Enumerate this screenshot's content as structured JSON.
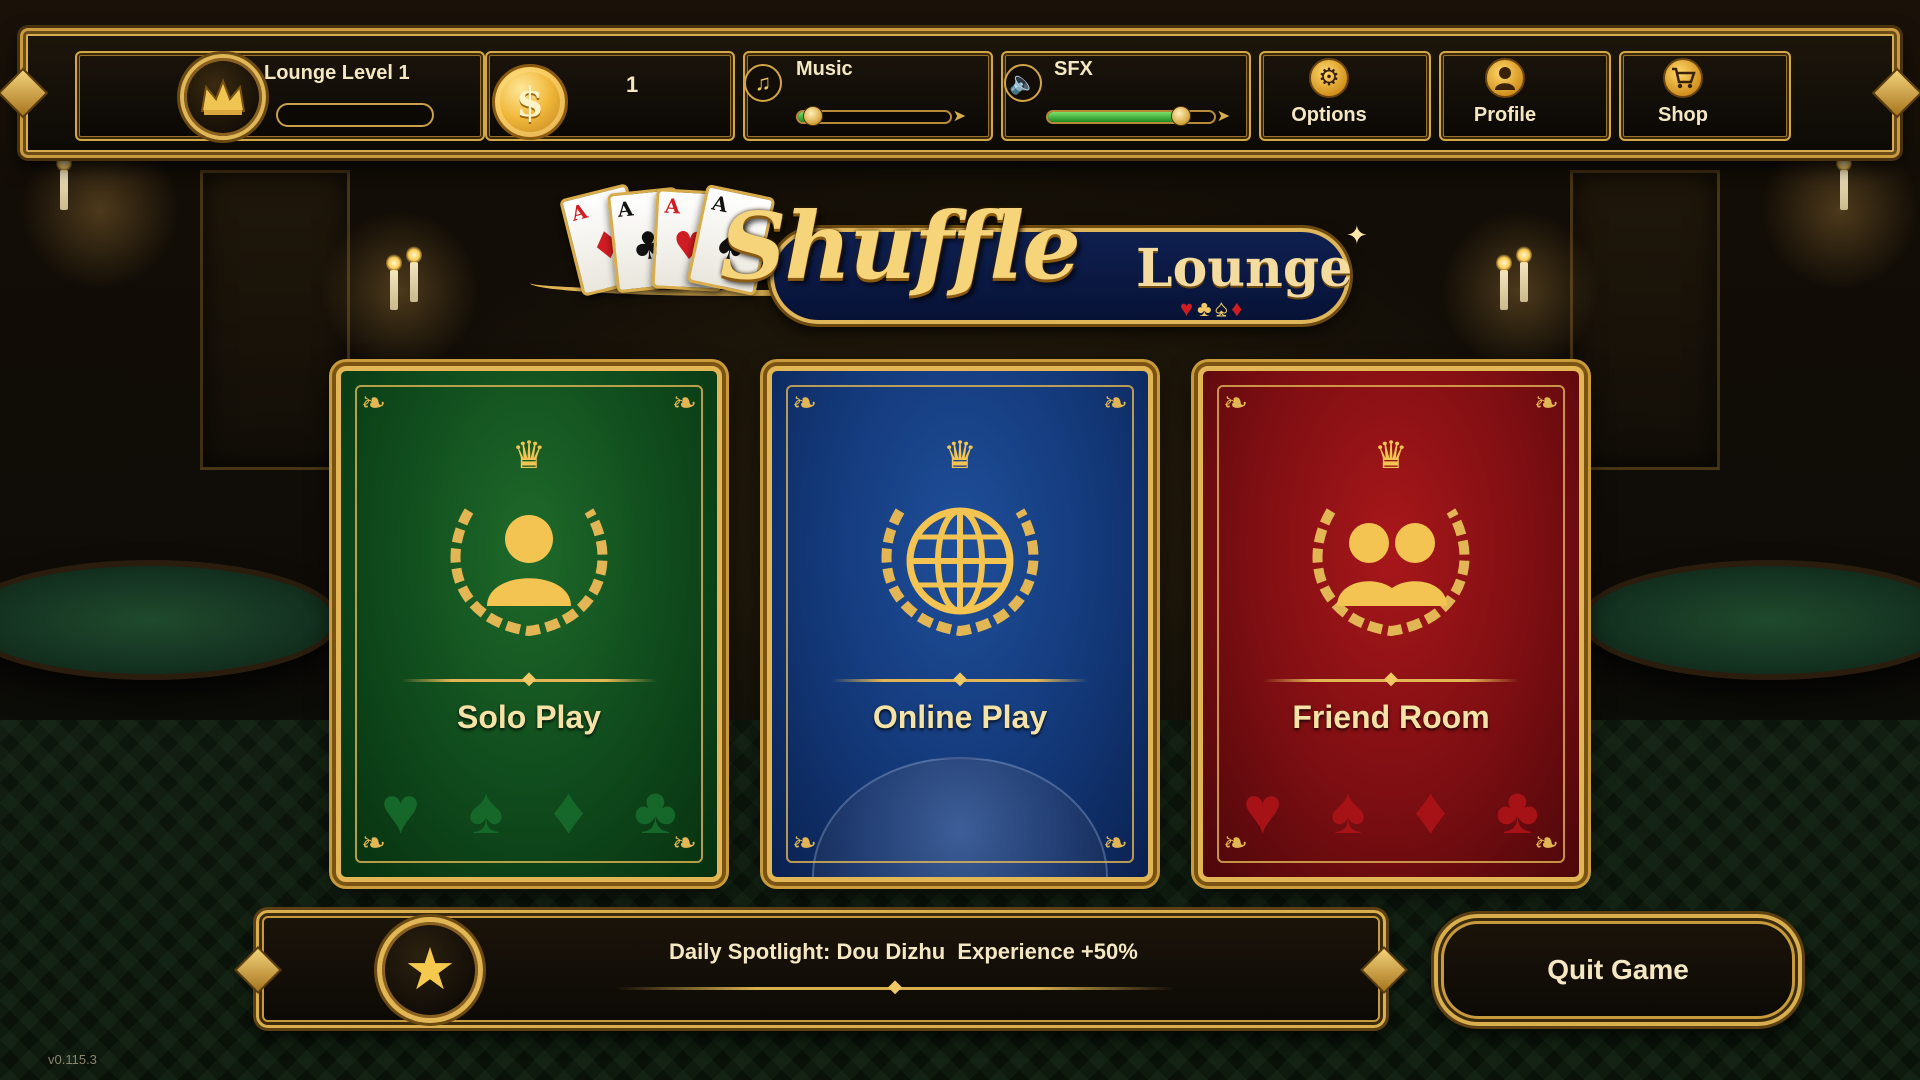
{
  "topbar": {
    "level": {
      "label": "Lounge Level 1",
      "progress": 0
    },
    "coins": {
      "count": "1"
    },
    "music": {
      "label": "Music",
      "volume": 0.1
    },
    "sfx": {
      "label": "SFX",
      "volume": 0.8
    },
    "buttons": {
      "options": {
        "label": "Options",
        "icon": "gear-icon"
      },
      "profile": {
        "label": "Profile",
        "icon": "profile-icon"
      },
      "shop": {
        "label": "Shop",
        "icon": "shopping-cart-icon"
      }
    }
  },
  "logo": {
    "title": "Shuffle",
    "subtitle": "Lounge",
    "cards": [
      {
        "rank": "A",
        "suit": "♦",
        "color": "#d01d24"
      },
      {
        "rank": "A",
        "suit": "♣",
        "color": "#111111"
      },
      {
        "rank": "A",
        "suit": "♥",
        "color": "#d01d24"
      },
      {
        "rank": "A",
        "suit": "♠",
        "color": "#111111"
      }
    ]
  },
  "modes": [
    {
      "title": "Solo Play",
      "icon": "single-player-icon",
      "color": "#0f4a1c"
    },
    {
      "title": "Online Play",
      "icon": "globe-icon",
      "color": "#133878"
    },
    {
      "title": "Friend Room",
      "icon": "two-players-icon",
      "color": "#7c0e12"
    }
  ],
  "spotlight": {
    "text": "Daily Spotlight: Dou Dizhu  Experience +50%",
    "icon": "star-icon"
  },
  "quit": {
    "label": "Quit Game"
  },
  "version": "v0.115.3",
  "colors": {
    "gold": "#d9ae4c",
    "accent_green": "#2d9b2a"
  }
}
